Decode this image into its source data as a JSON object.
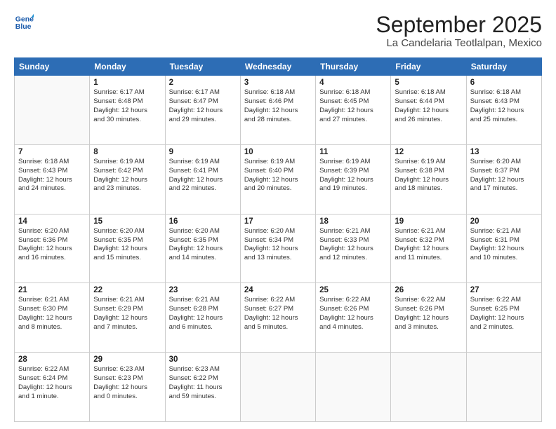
{
  "logo": {
    "line1": "General",
    "line2": "Blue"
  },
  "title": "September 2025",
  "location": "La Candelaria Teotlalpan, Mexico",
  "weekdays": [
    "Sunday",
    "Monday",
    "Tuesday",
    "Wednesday",
    "Thursday",
    "Friday",
    "Saturday"
  ],
  "weeks": [
    [
      {
        "day": "",
        "info": ""
      },
      {
        "day": "1",
        "info": "Sunrise: 6:17 AM\nSunset: 6:48 PM\nDaylight: 12 hours\nand 30 minutes."
      },
      {
        "day": "2",
        "info": "Sunrise: 6:17 AM\nSunset: 6:47 PM\nDaylight: 12 hours\nand 29 minutes."
      },
      {
        "day": "3",
        "info": "Sunrise: 6:18 AM\nSunset: 6:46 PM\nDaylight: 12 hours\nand 28 minutes."
      },
      {
        "day": "4",
        "info": "Sunrise: 6:18 AM\nSunset: 6:45 PM\nDaylight: 12 hours\nand 27 minutes."
      },
      {
        "day": "5",
        "info": "Sunrise: 6:18 AM\nSunset: 6:44 PM\nDaylight: 12 hours\nand 26 minutes."
      },
      {
        "day": "6",
        "info": "Sunrise: 6:18 AM\nSunset: 6:43 PM\nDaylight: 12 hours\nand 25 minutes."
      }
    ],
    [
      {
        "day": "7",
        "info": "Sunrise: 6:18 AM\nSunset: 6:43 PM\nDaylight: 12 hours\nand 24 minutes."
      },
      {
        "day": "8",
        "info": "Sunrise: 6:19 AM\nSunset: 6:42 PM\nDaylight: 12 hours\nand 23 minutes."
      },
      {
        "day": "9",
        "info": "Sunrise: 6:19 AM\nSunset: 6:41 PM\nDaylight: 12 hours\nand 22 minutes."
      },
      {
        "day": "10",
        "info": "Sunrise: 6:19 AM\nSunset: 6:40 PM\nDaylight: 12 hours\nand 20 minutes."
      },
      {
        "day": "11",
        "info": "Sunrise: 6:19 AM\nSunset: 6:39 PM\nDaylight: 12 hours\nand 19 minutes."
      },
      {
        "day": "12",
        "info": "Sunrise: 6:19 AM\nSunset: 6:38 PM\nDaylight: 12 hours\nand 18 minutes."
      },
      {
        "day": "13",
        "info": "Sunrise: 6:20 AM\nSunset: 6:37 PM\nDaylight: 12 hours\nand 17 minutes."
      }
    ],
    [
      {
        "day": "14",
        "info": "Sunrise: 6:20 AM\nSunset: 6:36 PM\nDaylight: 12 hours\nand 16 minutes."
      },
      {
        "day": "15",
        "info": "Sunrise: 6:20 AM\nSunset: 6:35 PM\nDaylight: 12 hours\nand 15 minutes."
      },
      {
        "day": "16",
        "info": "Sunrise: 6:20 AM\nSunset: 6:35 PM\nDaylight: 12 hours\nand 14 minutes."
      },
      {
        "day": "17",
        "info": "Sunrise: 6:20 AM\nSunset: 6:34 PM\nDaylight: 12 hours\nand 13 minutes."
      },
      {
        "day": "18",
        "info": "Sunrise: 6:21 AM\nSunset: 6:33 PM\nDaylight: 12 hours\nand 12 minutes."
      },
      {
        "day": "19",
        "info": "Sunrise: 6:21 AM\nSunset: 6:32 PM\nDaylight: 12 hours\nand 11 minutes."
      },
      {
        "day": "20",
        "info": "Sunrise: 6:21 AM\nSunset: 6:31 PM\nDaylight: 12 hours\nand 10 minutes."
      }
    ],
    [
      {
        "day": "21",
        "info": "Sunrise: 6:21 AM\nSunset: 6:30 PM\nDaylight: 12 hours\nand 8 minutes."
      },
      {
        "day": "22",
        "info": "Sunrise: 6:21 AM\nSunset: 6:29 PM\nDaylight: 12 hours\nand 7 minutes."
      },
      {
        "day": "23",
        "info": "Sunrise: 6:21 AM\nSunset: 6:28 PM\nDaylight: 12 hours\nand 6 minutes."
      },
      {
        "day": "24",
        "info": "Sunrise: 6:22 AM\nSunset: 6:27 PM\nDaylight: 12 hours\nand 5 minutes."
      },
      {
        "day": "25",
        "info": "Sunrise: 6:22 AM\nSunset: 6:26 PM\nDaylight: 12 hours\nand 4 minutes."
      },
      {
        "day": "26",
        "info": "Sunrise: 6:22 AM\nSunset: 6:26 PM\nDaylight: 12 hours\nand 3 minutes."
      },
      {
        "day": "27",
        "info": "Sunrise: 6:22 AM\nSunset: 6:25 PM\nDaylight: 12 hours\nand 2 minutes."
      }
    ],
    [
      {
        "day": "28",
        "info": "Sunrise: 6:22 AM\nSunset: 6:24 PM\nDaylight: 12 hours\nand 1 minute."
      },
      {
        "day": "29",
        "info": "Sunrise: 6:23 AM\nSunset: 6:23 PM\nDaylight: 12 hours\nand 0 minutes."
      },
      {
        "day": "30",
        "info": "Sunrise: 6:23 AM\nSunset: 6:22 PM\nDaylight: 11 hours\nand 59 minutes."
      },
      {
        "day": "",
        "info": ""
      },
      {
        "day": "",
        "info": ""
      },
      {
        "day": "",
        "info": ""
      },
      {
        "day": "",
        "info": ""
      }
    ]
  ]
}
